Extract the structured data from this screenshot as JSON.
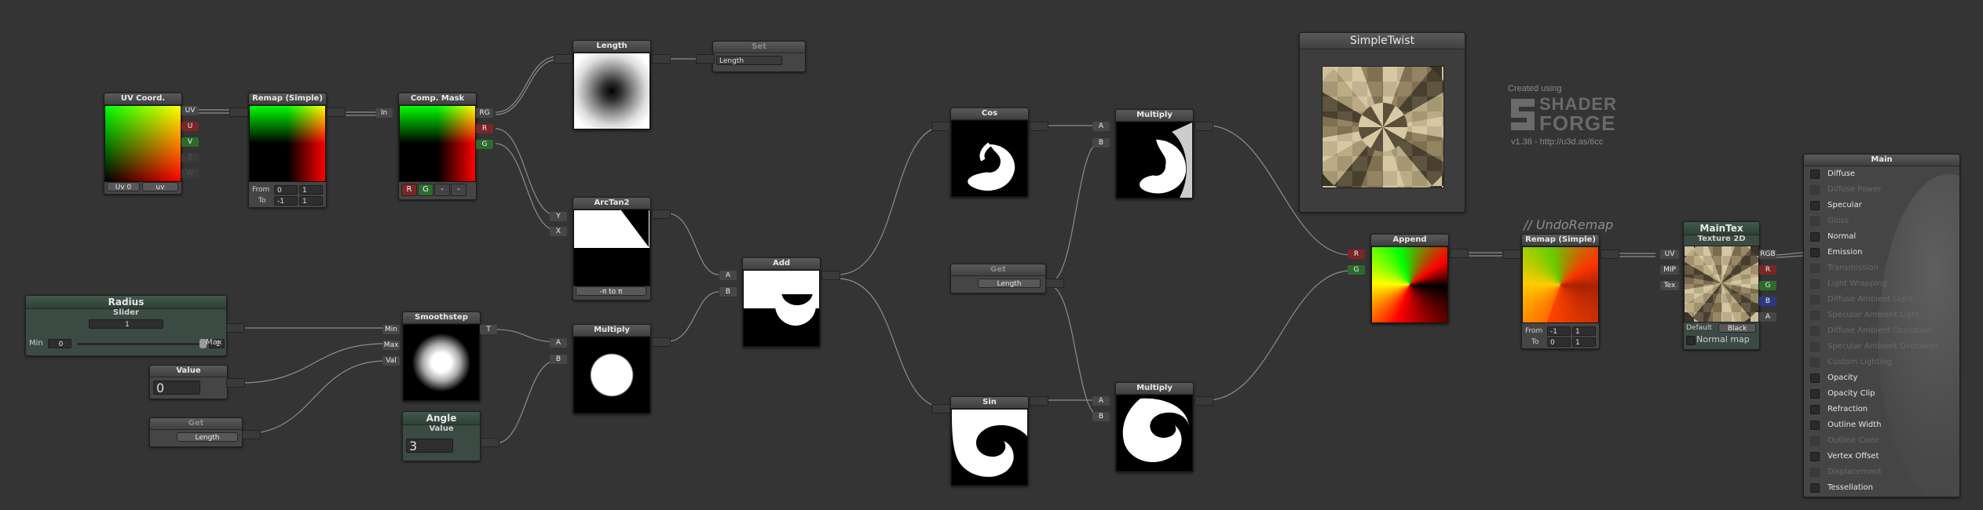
{
  "colors": {
    "background": "#343434",
    "node": "#454545",
    "wire": "#8c8c8c",
    "red_port": "#7a2626",
    "green_port": "#2d6b2d",
    "blue_port": "#2b3a80"
  },
  "nodes": {
    "uv_coord": {
      "title": "UV Coord.",
      "outputs": [
        "UV",
        "U",
        "V",
        "Z",
        "W"
      ],
      "uv_channel": "Uv 0",
      "uv_mode": "uv"
    },
    "remap1": {
      "title": "Remap (Simple)",
      "from_label": "From",
      "from_a": "0",
      "from_b": "1",
      "to_label": "To",
      "to_a": "-1",
      "to_b": "1"
    },
    "comp_mask": {
      "title": "Comp. Mask",
      "input": "In",
      "outputs": [
        "RG",
        "R",
        "G"
      ],
      "buttons": [
        "R",
        "G",
        "-",
        "-"
      ]
    },
    "length": {
      "title": "Length"
    },
    "set_node": {
      "title": "Set",
      "value": "Length"
    },
    "arctan2": {
      "title": "ArcTan2",
      "inputs": [
        "Y",
        "X"
      ],
      "mode": "-π to π"
    },
    "radius": {
      "title": "Radius",
      "subtitle": "Slider",
      "value": "1",
      "min_label": "Min",
      "min_value": "0",
      "max_value": "1",
      "max_label": "Max"
    },
    "value1": {
      "title": "Value",
      "value": "0"
    },
    "get1": {
      "title": "Get",
      "value": "Length"
    },
    "smoothstep": {
      "title": "Smoothstep",
      "inputs": [
        "Min",
        "Max",
        "Val"
      ],
      "output": "T"
    },
    "angle": {
      "title": "Angle",
      "subtitle": "Value",
      "value": "3"
    },
    "multiply_left": {
      "title": "Multiply",
      "inputs": [
        "A",
        "B"
      ]
    },
    "add": {
      "title": "Add",
      "inputs": [
        "A",
        "B"
      ]
    },
    "cos": {
      "title": "Cos"
    },
    "sin": {
      "title": "Sin"
    },
    "get2": {
      "title": "Get",
      "value": "Length"
    },
    "multiply_top": {
      "title": "Multiply",
      "inputs": [
        "A",
        "B"
      ]
    },
    "multiply_bottom": {
      "title": "Multiply",
      "inputs": [
        "A",
        "B"
      ]
    },
    "simpletwist": {
      "title": "SimpleTwist"
    },
    "append": {
      "title": "Append",
      "inputs": [
        "R",
        "G"
      ]
    },
    "remap2": {
      "title": "Remap (Simple)",
      "comment": "// UndoRemap",
      "from_label": "From",
      "from_a": "-1",
      "from_b": "1",
      "to_label": "To",
      "to_a": "0",
      "to_b": "1"
    },
    "maintex": {
      "title": "MainTex",
      "subtitle": "Texture 2D",
      "inputs": [
        "UV",
        "MIP",
        "Tex"
      ],
      "outputs": [
        "RGB",
        "R",
        "G",
        "B",
        "A"
      ],
      "default_label": "Default",
      "default_value": "Black",
      "normal_map_label": "Normal map"
    }
  },
  "watermark": {
    "created": "Created using",
    "line1": "SHADER",
    "line2": "FORGE",
    "version": "v1.38 - http://u3d.as/6cc"
  },
  "main_panel": {
    "title": "Main",
    "inputs": [
      {
        "label": "Diffuse",
        "enabled": true
      },
      {
        "label": "Diffuse Power",
        "enabled": false
      },
      {
        "label": "Specular",
        "enabled": true
      },
      {
        "label": "Gloss",
        "enabled": false
      },
      {
        "label": "Normal",
        "enabled": true
      },
      {
        "label": "Emission",
        "enabled": true
      },
      {
        "label": "Transmission",
        "enabled": false
      },
      {
        "label": "Light Wrapping",
        "enabled": false
      },
      {
        "label": "Diffuse Ambient Light",
        "enabled": false
      },
      {
        "label": "Specular Ambient Light",
        "enabled": false
      },
      {
        "label": "Diffuse Ambient Occlusion",
        "enabled": false
      },
      {
        "label": "Specular Ambient Occlusion",
        "enabled": false
      },
      {
        "label": "Custom Lighting",
        "enabled": false
      },
      {
        "label": "Opacity",
        "enabled": true
      },
      {
        "label": "Opacity Clip",
        "enabled": true
      },
      {
        "label": "Refraction",
        "enabled": true
      },
      {
        "label": "Outline Width",
        "enabled": true
      },
      {
        "label": "Outline Color",
        "enabled": false
      },
      {
        "label": "Vertex Offset",
        "enabled": true
      },
      {
        "label": "Displacement",
        "enabled": false
      },
      {
        "label": "Tessellation",
        "enabled": true
      }
    ]
  }
}
